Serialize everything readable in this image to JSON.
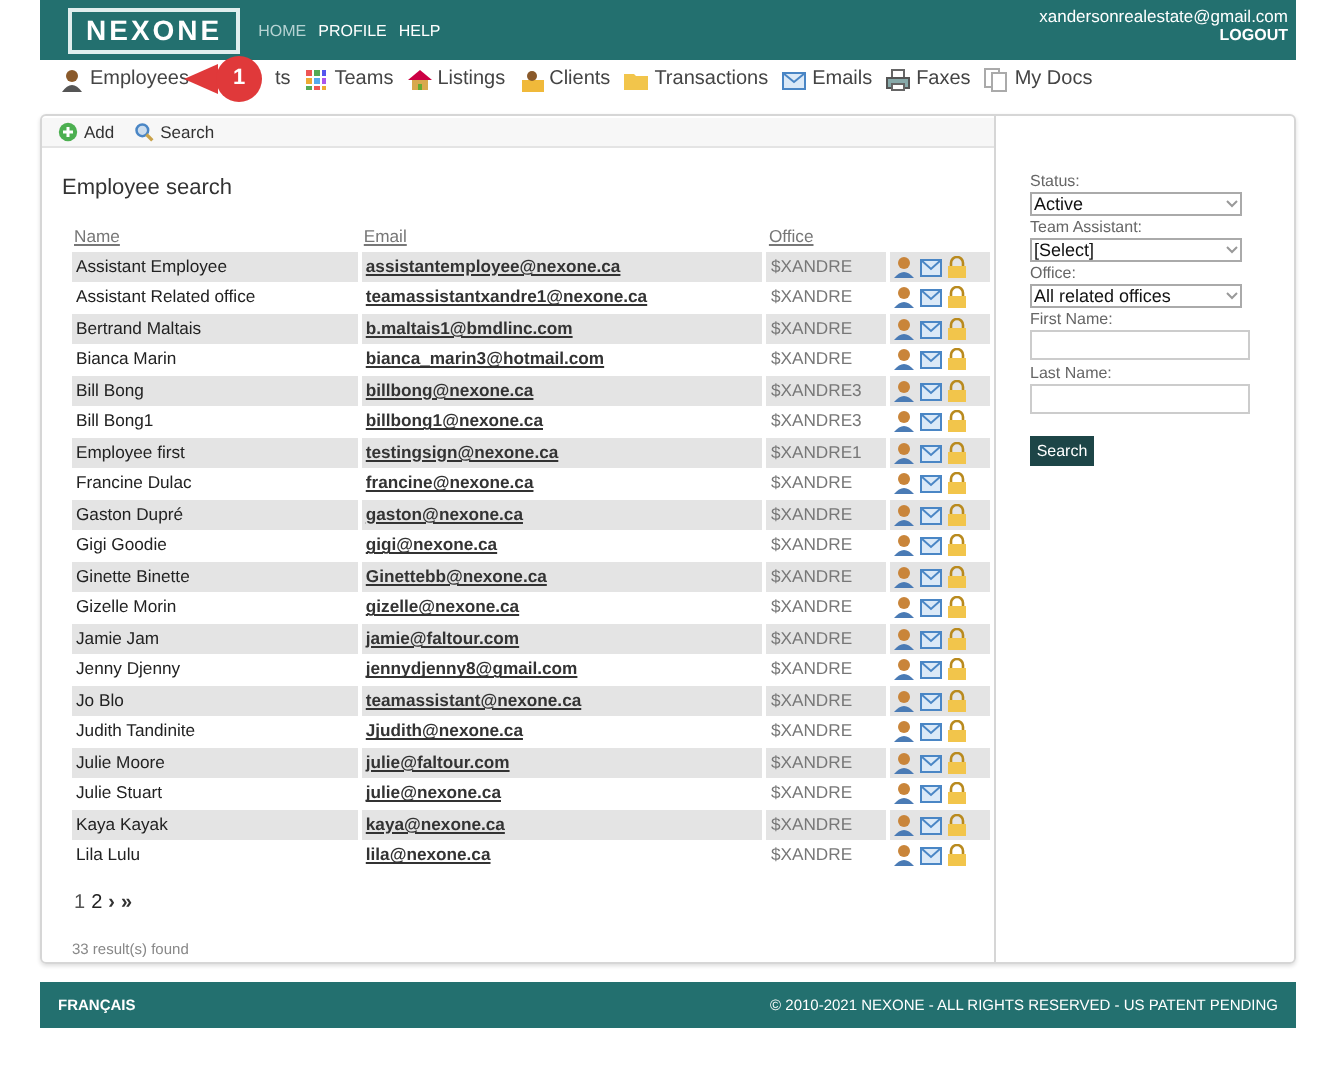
{
  "header": {
    "logo": "NEXONE",
    "links": [
      {
        "label": "HOME",
        "selected": true
      },
      {
        "label": "PROFILE",
        "selected": false
      },
      {
        "label": "HELP",
        "selected": false
      }
    ],
    "user_email": "xandersonrealestate@gmail.com",
    "logout": "LOGOUT"
  },
  "nav": [
    {
      "label": "Employees",
      "kind": "person"
    },
    {
      "label": "ts",
      "kind": "covered"
    },
    {
      "label": "Teams",
      "kind": "grid"
    },
    {
      "label": "Listings",
      "kind": "house"
    },
    {
      "label": "Clients",
      "kind": "client"
    },
    {
      "label": "Transactions",
      "kind": "folder"
    },
    {
      "label": "Emails",
      "kind": "mail"
    },
    {
      "label": "Faxes",
      "kind": "printer"
    },
    {
      "label": "My Docs",
      "kind": "docs"
    }
  ],
  "callout": {
    "number": "1"
  },
  "toolbar": [
    {
      "label": "Add",
      "kind": "add"
    },
    {
      "label": "Search",
      "kind": "search"
    }
  ],
  "title": "Employee search",
  "table": {
    "columns": [
      "Name",
      "Email",
      "Office"
    ],
    "rows": [
      {
        "name": "Assistant Employee",
        "email": "assistantemployee@nexone.ca",
        "office": "$XANDRE"
      },
      {
        "name": "Assistant Related office",
        "email": "teamassistantxandre1@nexone.ca",
        "office": "$XANDRE"
      },
      {
        "name": "Bertrand Maltais",
        "email": "b.maltais1@bmdlinc.com",
        "office": "$XANDRE"
      },
      {
        "name": "Bianca Marin",
        "email": "bianca_marin3@hotmail.com",
        "office": "$XANDRE"
      },
      {
        "name": "Bill Bong",
        "email": "billbong@nexone.ca",
        "office": "$XANDRE3"
      },
      {
        "name": "Bill Bong1",
        "email": "billbong1@nexone.ca",
        "office": "$XANDRE3"
      },
      {
        "name": "Employee first",
        "email": "testingsign@nexone.ca",
        "office": "$XANDRE1"
      },
      {
        "name": "Francine Dulac",
        "email": "francine@nexone.ca",
        "office": "$XANDRE"
      },
      {
        "name": "Gaston Dupré",
        "email": "gaston@nexone.ca",
        "office": "$XANDRE"
      },
      {
        "name": "Gigi Goodie",
        "email": "gigi@nexone.ca",
        "office": "$XANDRE"
      },
      {
        "name": "Ginette Binette",
        "email": "Ginettebb@nexone.ca",
        "office": "$XANDRE"
      },
      {
        "name": "Gizelle Morin",
        "email": "gizelle@nexone.ca",
        "office": "$XANDRE"
      },
      {
        "name": "Jamie Jam",
        "email": "jamie@faltour.com",
        "office": "$XANDRE"
      },
      {
        "name": "Jenny Djenny",
        "email": "jennydjenny8@gmail.com",
        "office": "$XANDRE"
      },
      {
        "name": "Jo Blo",
        "email": "teamassistant@nexone.ca",
        "office": "$XANDRE"
      },
      {
        "name": "Judith Tandinite",
        "email": "Jjudith@nexone.ca",
        "office": "$XANDRE"
      },
      {
        "name": "Julie Moore",
        "email": "julie@faltour.com",
        "office": "$XANDRE"
      },
      {
        "name": "Julie Stuart",
        "email": "julie@nexone.ca",
        "office": "$XANDRE"
      },
      {
        "name": "Kaya Kayak",
        "email": "kaya@nexone.ca",
        "office": "$XANDRE"
      },
      {
        "name": "Lila Lulu",
        "email": "lila@nexone.ca",
        "office": "$XANDRE"
      }
    ]
  },
  "pagination": [
    {
      "label": "1",
      "kind": "page",
      "selected": true
    },
    {
      "label": "2",
      "kind": "page",
      "selected": false
    },
    {
      "label": "›",
      "kind": "arrow",
      "selected": false
    },
    {
      "label": "»",
      "kind": "arrow",
      "selected": false
    }
  ],
  "result_count": "33 result(s) found",
  "filters": [
    {
      "label": "Status:",
      "kind": "select",
      "value": "Active"
    },
    {
      "label": "Team Assistant:",
      "kind": "select",
      "value": "[Select]"
    },
    {
      "label": "Office:",
      "kind": "select",
      "value": "All related offices"
    },
    {
      "label": "First Name:",
      "kind": "text"
    },
    {
      "label": "Last Name:",
      "kind": "text"
    }
  ],
  "search_button": "Search",
  "footer": {
    "language": "FRANÇAIS",
    "copyright": "© 2010-2021 NEXONE - ALL RIGHTS RESERVED - US PATENT PENDING"
  }
}
